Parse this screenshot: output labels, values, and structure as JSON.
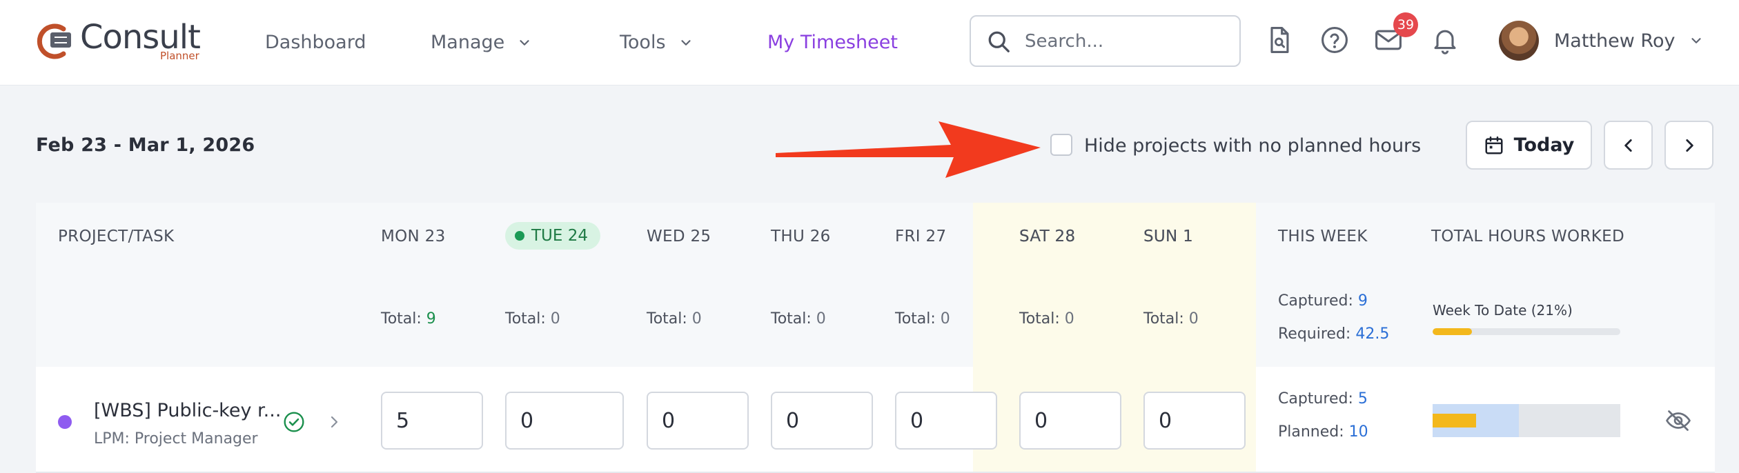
{
  "brand": {
    "name": "Consult",
    "sub": "Planner",
    "mark_color": "#c0502a"
  },
  "nav": {
    "items": [
      {
        "label": "Dashboard",
        "has_menu": false
      },
      {
        "label": "Manage",
        "has_menu": true
      },
      {
        "label": "Tools",
        "has_menu": true
      },
      {
        "label": "My Timesheet",
        "has_menu": false,
        "active": true
      }
    ],
    "active_color": "#8a3fe0"
  },
  "search": {
    "placeholder": "Search...",
    "value": ""
  },
  "header_icons": {
    "icons": [
      "document-search-icon",
      "help-icon",
      "mail-icon",
      "bell-icon"
    ],
    "mail_badge": "39",
    "badge_color": "#e5484d"
  },
  "user": {
    "name": "Matthew Roy"
  },
  "toolbar": {
    "date_range": "Feb 23 - Mar 1, 2026",
    "hide_label": "Hide projects with no planned hours",
    "hide_checked": false,
    "today_label": "Today",
    "annotation": "red-arrow-pointing-to-checkbox"
  },
  "table": {
    "headers": {
      "project": "PROJECT/TASK",
      "days": [
        "MON 23",
        "TUE 24",
        "WED 25",
        "THU 26",
        "FRI 27",
        "SAT 28",
        "SUN 1"
      ],
      "this_week": "THIS WEEK",
      "total_hours": "TOTAL HOURS WORKED"
    },
    "today_index": 1,
    "total_prefix": "Total:",
    "day_totals": [
      "9",
      "0",
      "0",
      "0",
      "0",
      "0",
      "0"
    ],
    "week": {
      "captured_label": "Captured:",
      "captured": "9",
      "required_label": "Required:",
      "required": "42.5"
    },
    "week_to_date": {
      "label": "Week To Date (21%)",
      "percent": 21
    },
    "rows": [
      {
        "title": "[WBS] Public-key r...",
        "subtitle": "LPM: Project Manager",
        "dot_color": "#8f5cf0",
        "approved": true,
        "hours": [
          "5",
          "0",
          "0",
          "0",
          "0",
          "0",
          "0"
        ],
        "captured_label": "Captured:",
        "captured": "5",
        "planned_label": "Planned:",
        "planned": "10",
        "bar_planned_fraction": 0.46,
        "bar_actual_fraction": 0.23
      }
    ]
  },
  "colors": {
    "accent_blue": "#2b6fd6",
    "today_green": "#1a8f4c",
    "weekend_bg": "#fdfbea",
    "progress_yellow": "#f3b81c"
  }
}
